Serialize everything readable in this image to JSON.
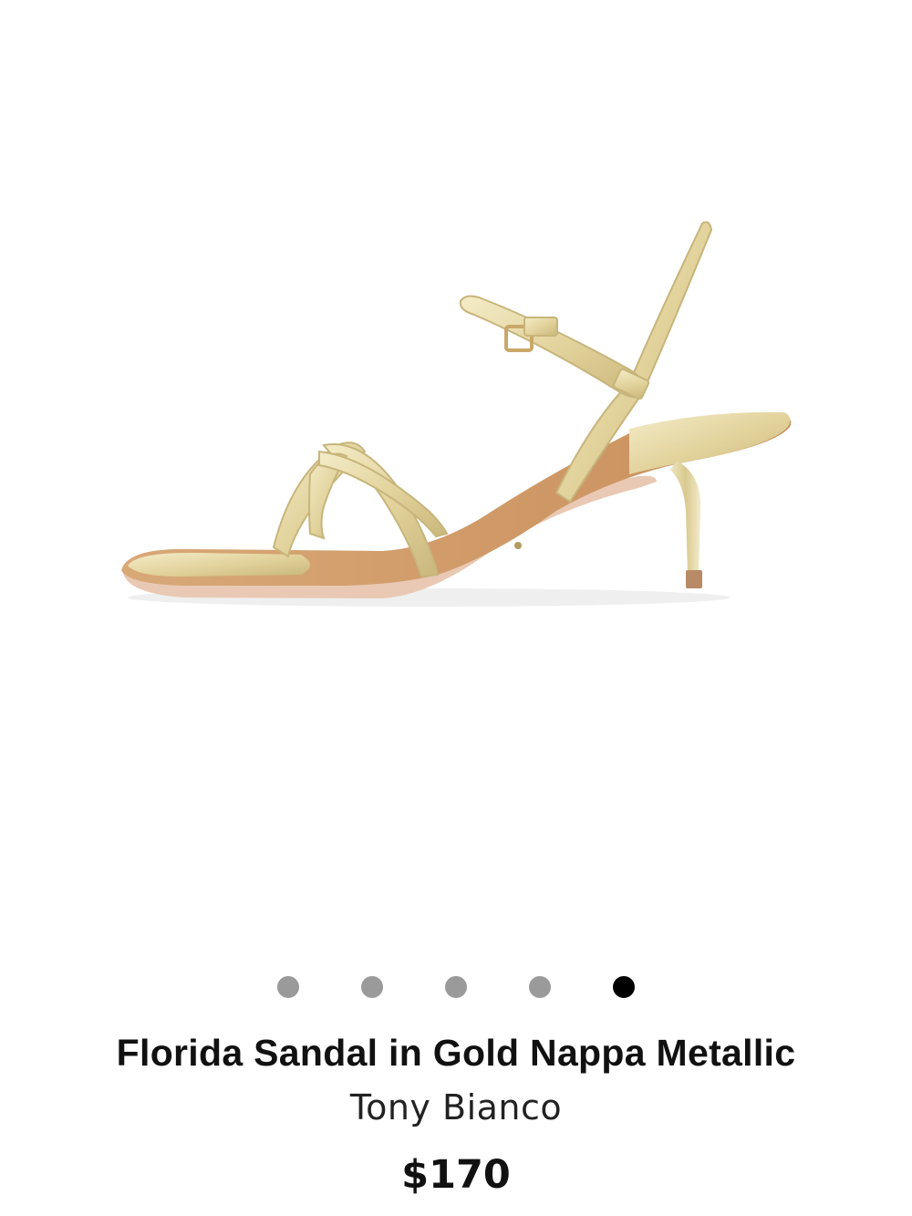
{
  "product": {
    "image_alt": "Florida Sandal in Gold Nappa Metallic",
    "title": "Florida Sandal in Gold Nappa Metallic",
    "brand": "Tony Bianco",
    "price": "$170"
  },
  "carousel": {
    "total": 5,
    "active_index": 4
  },
  "colors": {
    "dot_inactive": "#9a9a9a",
    "dot_active": "#000000",
    "gold": "#e7dcb0"
  }
}
